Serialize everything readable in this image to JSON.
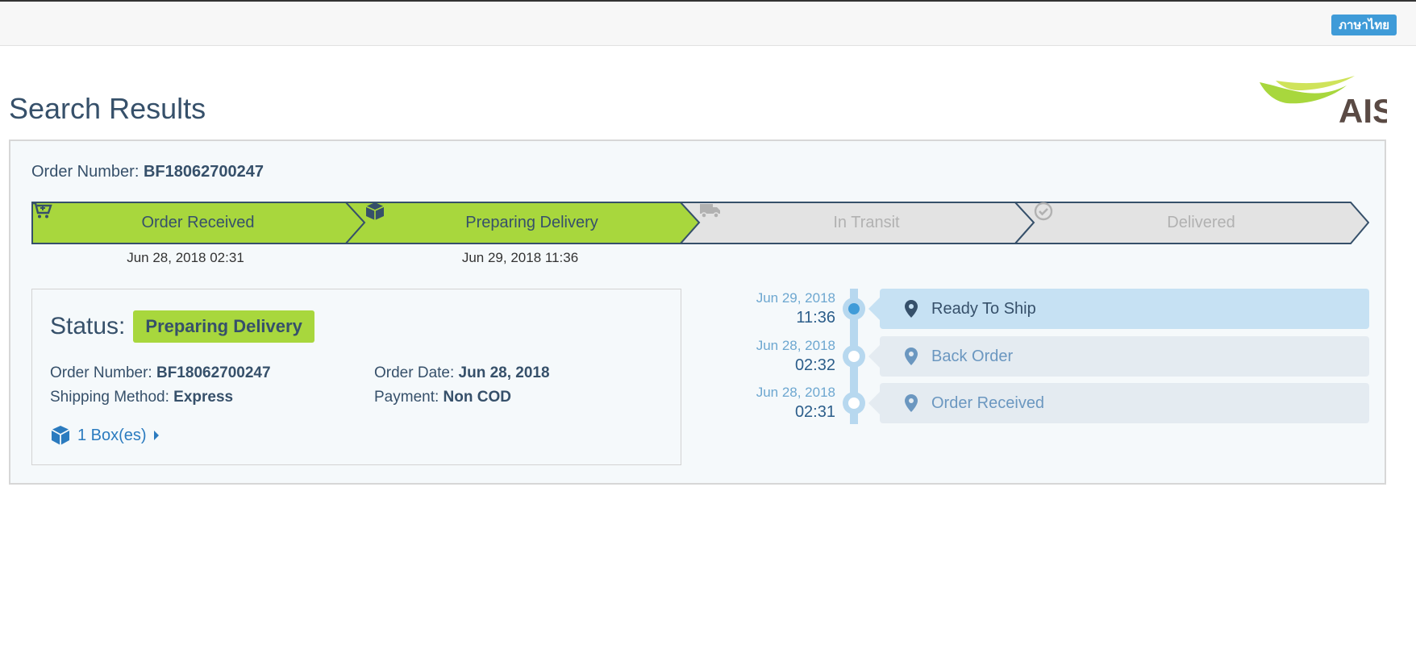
{
  "header": {
    "language_button": "ภาษาไทย"
  },
  "page_title": "Search Results",
  "logo": {
    "text": "AIS",
    "colors": {
      "swoosh": "#a8d73d",
      "text": "#5a4a44"
    }
  },
  "order": {
    "number_label": "Order Number:",
    "number": "BF18062700247"
  },
  "steps": [
    {
      "label": "Order Received",
      "icon": "cart-icon",
      "state": "done",
      "date": "Jun 28, 2018 02:31"
    },
    {
      "label": "Preparing Delivery",
      "icon": "box-icon",
      "state": "done",
      "date": "Jun 29, 2018 11:36"
    },
    {
      "label": "In Transit",
      "icon": "truck-icon",
      "state": "pending",
      "date": ""
    },
    {
      "label": "Delivered",
      "icon": "check-circle-icon",
      "state": "pending",
      "date": ""
    }
  ],
  "status": {
    "label": "Status:",
    "value": "Preparing Delivery",
    "order_number_label": "Order Number:",
    "order_number": "BF18062700247",
    "order_date_label": "Order Date:",
    "order_date": "Jun 28, 2018",
    "shipping_label": "Shipping Method:",
    "shipping": "Express",
    "payment_label": "Payment:",
    "payment": "Non COD",
    "boxes_link": "1 Box(es)"
  },
  "timeline": [
    {
      "date": "Jun 29, 2018",
      "time": "11:36",
      "label": "Ready To Ship",
      "active": true
    },
    {
      "date": "Jun 28, 2018",
      "time": "02:32",
      "label": "Back Order",
      "active": false
    },
    {
      "date": "Jun 28, 2018",
      "time": "02:31",
      "label": "Order Received",
      "active": false
    }
  ],
  "colors": {
    "accent_green": "#a8d73d",
    "accent_blue": "#3f9bd8",
    "text_dark": "#36506a"
  }
}
